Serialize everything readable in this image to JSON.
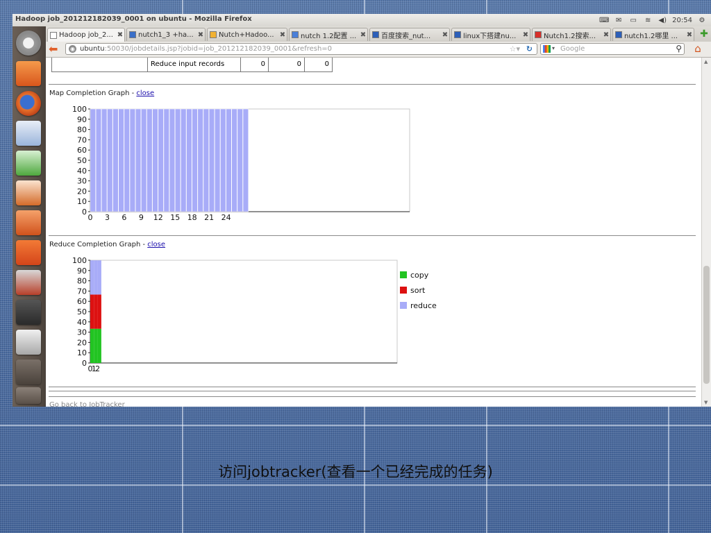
{
  "window": {
    "title": "Hadoop job_201212182039_0001 on ubuntu - Mozilla Firefox",
    "clock": "20:54"
  },
  "tabs": [
    {
      "label": "Hadoop job_2...",
      "active": true
    },
    {
      "label": "nutch1_3 +ha..."
    },
    {
      "label": "Nutch+Hadoo..."
    },
    {
      "label": "nutch 1.2配置 ..."
    },
    {
      "label": "百度搜索_nut..."
    },
    {
      "label": "linux下搭建nu..."
    },
    {
      "label": "Nutch1.2搜索..."
    },
    {
      "label": "nutch1.2哪里 ..."
    }
  ],
  "address": {
    "host": "ubuntu",
    "rest": ":50030/jobdetails.jsp?jobid=job_201212182039_0001&refresh=0"
  },
  "search": {
    "placeholder": "Google"
  },
  "counters_row": {
    "label": "Reduce input records",
    "map": "0",
    "reduce": "0",
    "total": "0"
  },
  "map_graph": {
    "title_prefix": "Map Completion Graph - ",
    "close_label": "close"
  },
  "reduce_graph": {
    "title_prefix": "Reduce Completion Graph - ",
    "close_label": "close"
  },
  "footer_link": "Go back to JobTracker",
  "caption": "访问jobtracker(查看一个已经完成的任务)",
  "colors": {
    "copy": "#22c422",
    "sort": "#dd1111",
    "reduce": "#a8acf8",
    "map": "#a8acf8"
  },
  "chart_data": [
    {
      "type": "bar",
      "categories": [
        "0",
        "1",
        "2",
        "3",
        "4",
        "5",
        "6",
        "7",
        "8",
        "9",
        "10",
        "11",
        "12",
        "13",
        "14",
        "15",
        "16",
        "17",
        "18",
        "19",
        "20",
        "21",
        "22",
        "23",
        "24",
        "25",
        "26",
        "27"
      ],
      "values": [
        100,
        100,
        100,
        100,
        100,
        100,
        100,
        100,
        100,
        100,
        100,
        100,
        100,
        100,
        100,
        100,
        100,
        100,
        100,
        100,
        100,
        100,
        100,
        100,
        100,
        100,
        100,
        100
      ],
      "x_ticks": [
        "0",
        "3",
        "6",
        "9",
        "12",
        "15",
        "18",
        "21",
        "24"
      ],
      "y_ticks": [
        "0",
        "10",
        "20",
        "30",
        "40",
        "50",
        "60",
        "70",
        "80",
        "90",
        "100"
      ],
      "ylim": [
        0,
        100
      ]
    },
    {
      "type": "bar",
      "categories": [
        "0",
        "1",
        "2"
      ],
      "series": [
        {
          "name": "copy",
          "values": [
            33.3,
            33.3,
            33.3
          ]
        },
        {
          "name": "sort",
          "values": [
            33.3,
            33.3,
            33.3
          ]
        },
        {
          "name": "reduce",
          "values": [
            33.3,
            33.3,
            33.3
          ]
        }
      ],
      "x_ticks": [
        "0",
        "1",
        "2"
      ],
      "y_ticks": [
        "0",
        "10",
        "20",
        "30",
        "40",
        "50",
        "60",
        "70",
        "80",
        "90",
        "100"
      ],
      "ylim": [
        0,
        100
      ],
      "stacked": true,
      "legend": "right"
    }
  ]
}
